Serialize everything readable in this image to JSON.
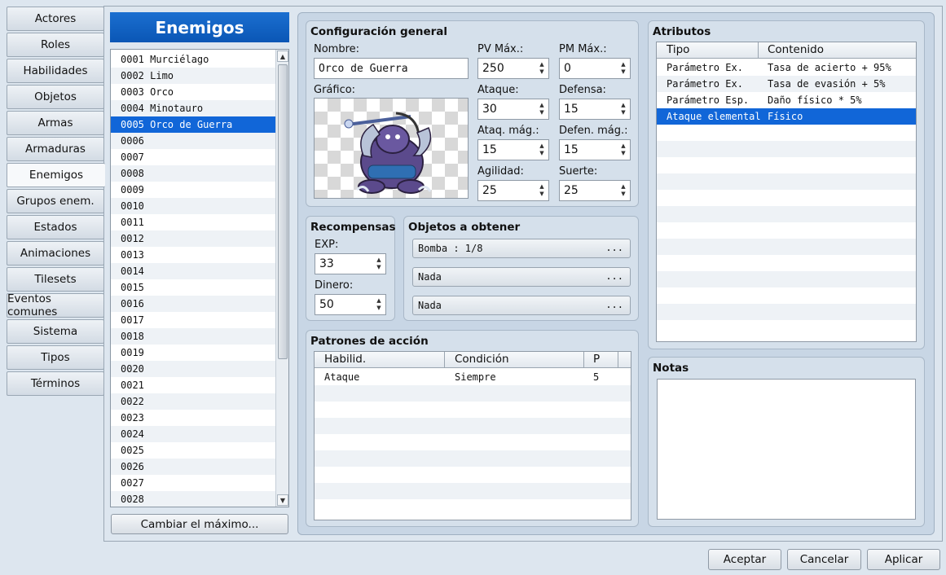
{
  "tabs": [
    "Actores",
    "Roles",
    "Habilidades",
    "Objetos",
    "Armas",
    "Armaduras",
    "Enemigos",
    "Grupos enem.",
    "Estados",
    "Animaciones",
    "Tilesets",
    "Eventos comunes",
    "Sistema",
    "Tipos",
    "Términos"
  ],
  "active_tab": "Enemigos",
  "list": {
    "title": "Enemigos",
    "items": [
      "0001 Murciélago",
      "0002 Limo",
      "0003 Orco",
      "0004 Minotauro",
      "0005 Orco de Guerra",
      "0006",
      "0007",
      "0008",
      "0009",
      "0010",
      "0011",
      "0012",
      "0013",
      "0014",
      "0015",
      "0016",
      "0017",
      "0018",
      "0019",
      "0020",
      "0021",
      "0022",
      "0023",
      "0024",
      "0025",
      "0026",
      "0027",
      "0028"
    ],
    "selected_index": 4,
    "change_max_label": "Cambiar el máximo..."
  },
  "general": {
    "title": "Configuración general",
    "name_label": "Nombre:",
    "name_value": "Orco de Guerra",
    "graphic_label": "Gráfico:",
    "stats": {
      "mhp_label": "PV Máx.:",
      "mhp": "250",
      "mmp_label": "PM Máx.:",
      "mmp": "0",
      "atk_label": "Ataque:",
      "atk": "30",
      "def_label": "Defensa:",
      "def": "15",
      "mat_label": "Ataq. mág.:",
      "mat": "15",
      "mdf_label": "Defen. mág.:",
      "mdf": "15",
      "agi_label": "Agilidad:",
      "agi": "25",
      "luk_label": "Suerte:",
      "luk": "25"
    }
  },
  "rewards": {
    "title": "Recompensas",
    "exp_label": "EXP:",
    "exp": "33",
    "gold_label": "Dinero:",
    "gold": "50"
  },
  "drops": {
    "title": "Objetos a obtener",
    "items": [
      "Bomba : 1/8",
      "Nada",
      "Nada"
    ],
    "more": "..."
  },
  "actions": {
    "title": "Patrones de acción",
    "headers": [
      "Habilid.",
      "Condición",
      "P"
    ],
    "rows": [
      [
        "Ataque",
        "Siempre",
        "5"
      ]
    ]
  },
  "traits": {
    "title": "Atributos",
    "headers": [
      "Tipo",
      "Contenido"
    ],
    "rows": [
      [
        "Parámetro Ex.",
        "Tasa de acierto + 95%"
      ],
      [
        "Parámetro Ex.",
        "Tasa de evasión + 5%"
      ],
      [
        "Parámetro Esp.",
        "Daño físico * 5%"
      ],
      [
        "Ataque elemental",
        "Físico"
      ]
    ],
    "selected_index": 3
  },
  "notes": {
    "title": "Notas",
    "value": ""
  },
  "footer": {
    "ok": "Aceptar",
    "cancel": "Cancelar",
    "apply": "Aplicar"
  },
  "colors": {
    "accent": "#1166d8",
    "panel": "#d5e0eb",
    "background": "#dde6ef"
  }
}
